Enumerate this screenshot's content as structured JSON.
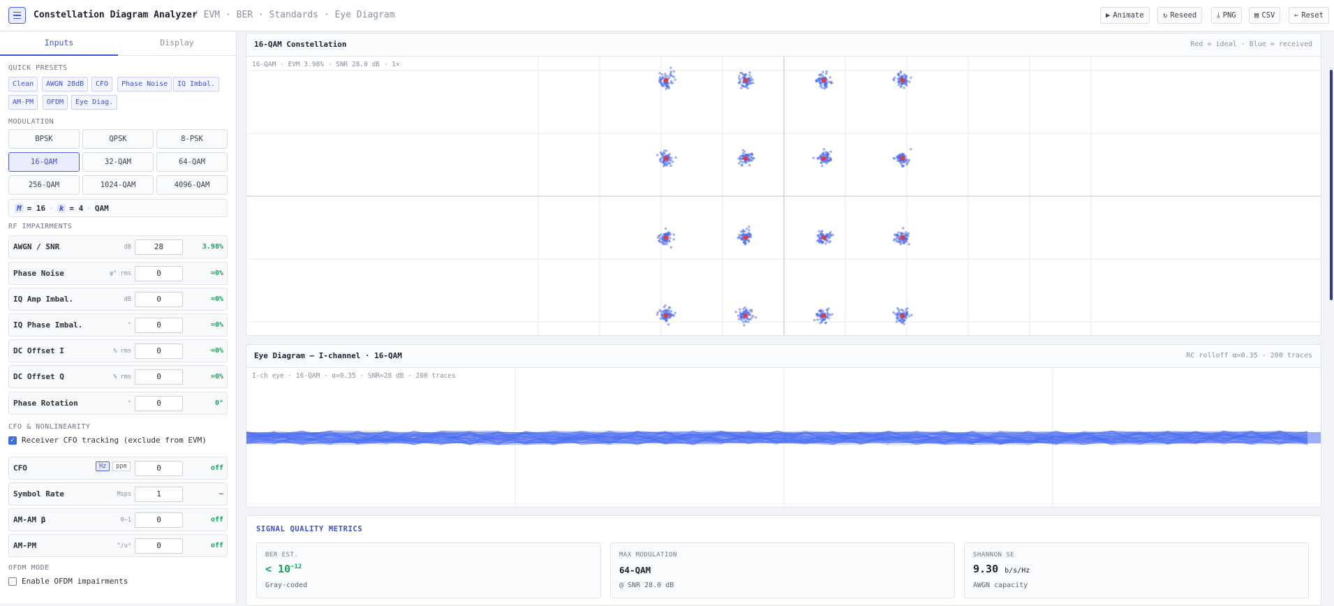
{
  "header": {
    "title": "Constellation Diagram Analyzer",
    "breadcrumb": "/ EVM · BER · Standards · Eye Diagram",
    "buttons": [
      "Animate",
      "Reseed",
      "PNG",
      "CSV",
      "Reset"
    ],
    "button_icons": [
      "play-icon",
      "refresh-icon",
      "download-icon",
      "file-icon",
      "back-arrow-icon"
    ]
  },
  "sidebar": {
    "tabs": [
      "Inputs",
      "Display"
    ],
    "active_tab": "Inputs",
    "presets_heading": "QUICK PRESETS",
    "presets": [
      "Clean",
      "AWGN 28dB",
      "CFO",
      "Phase Noise",
      "IQ Imbal.",
      "AM-PM",
      "OFDM",
      "Eye Diag."
    ],
    "modulation_heading": "MODULATION",
    "modulations": [
      "BPSK",
      "QPSK",
      "8-PSK",
      "16-QAM",
      "32-QAM",
      "64-QAM",
      "256-QAM",
      "1024-QAM",
      "4096-QAM"
    ],
    "selected_modulation": "16-QAM",
    "mk": {
      "m_tag": "M",
      "m_val": "= 16",
      "k_tag": "k",
      "k_val": "= 4",
      "family": "QAM"
    },
    "rf_heading": "RF IMPAIRMENTS",
    "rf": [
      {
        "label": "AWGN / SNR",
        "unit": "dB",
        "value": "28",
        "result": "3.98%"
      },
      {
        "label": "Phase Noise",
        "unit": "φ° rms",
        "value": "0",
        "result": "≈0%"
      },
      {
        "label": "IQ Amp Imbal.",
        "unit": "dB",
        "value": "0",
        "result": "≈0%"
      },
      {
        "label": "IQ Phase Imbal.",
        "unit": "°",
        "value": "0",
        "result": "≈0%"
      },
      {
        "label": "DC Offset I",
        "unit": "% rms",
        "value": "0",
        "result": "≈0%"
      },
      {
        "label": "DC Offset Q",
        "unit": "% rms",
        "value": "0",
        "result": "≈0%"
      },
      {
        "label": "Phase Rotation",
        "unit": "°",
        "value": "0",
        "result": "0°"
      }
    ],
    "cfo_heading": "CFO & NONLINEARITY",
    "cfo_tracking_label": "Receiver CFO tracking (exclude from EVM)",
    "cfo_tracking_checked": true,
    "cfo": {
      "label": "CFO",
      "unit_hz": "Hz",
      "unit_ppm": "ppm",
      "value": "0",
      "result": "off"
    },
    "nonlin": [
      {
        "label": "Symbol Rate",
        "unit": "Msps",
        "value": "1",
        "result": "—"
      },
      {
        "label": "AM-AM β",
        "unit": "0–1",
        "value": "0",
        "result": "off"
      },
      {
        "label": "AM-PM",
        "unit": "°/u²",
        "value": "0",
        "result": "off"
      }
    ],
    "ofdm_heading": "OFDM MODE",
    "ofdm_label": "Enable OFDM impairments",
    "ofdm_checked": false
  },
  "constellation": {
    "title": "16-QAM Constellation",
    "legend": "Red = ideal · Blue = received",
    "info": "16-QAM  ·  EVM 3.98%  ·  SNR 28.0 dB  ·  1×",
    "colors": {
      "ideal": "#e53935",
      "received": "#4b6cf0"
    }
  },
  "eye": {
    "title": "Eye Diagram — I-channel · 16-QAM",
    "right": "RC rolloff α=0.35 · 200 traces",
    "info": "I-ch eye · 16-QAM · α=0.35 · SNR=28 dB · 200 traces"
  },
  "metrics": {
    "heading": "SIGNAL QUALITY METRICS",
    "cards": [
      {
        "title": "BER EST.",
        "value": "< 10",
        "exp": "−12",
        "sub": "Gray-coded"
      },
      {
        "title": "MAX MODULATION",
        "value": "64-QAM",
        "sub": "@ SNR 28.0 dB"
      },
      {
        "title": "SHANNON SE",
        "value": "9.30",
        "unit": "b/s/Hz",
        "sub": "AWGN capacity"
      }
    ]
  }
}
